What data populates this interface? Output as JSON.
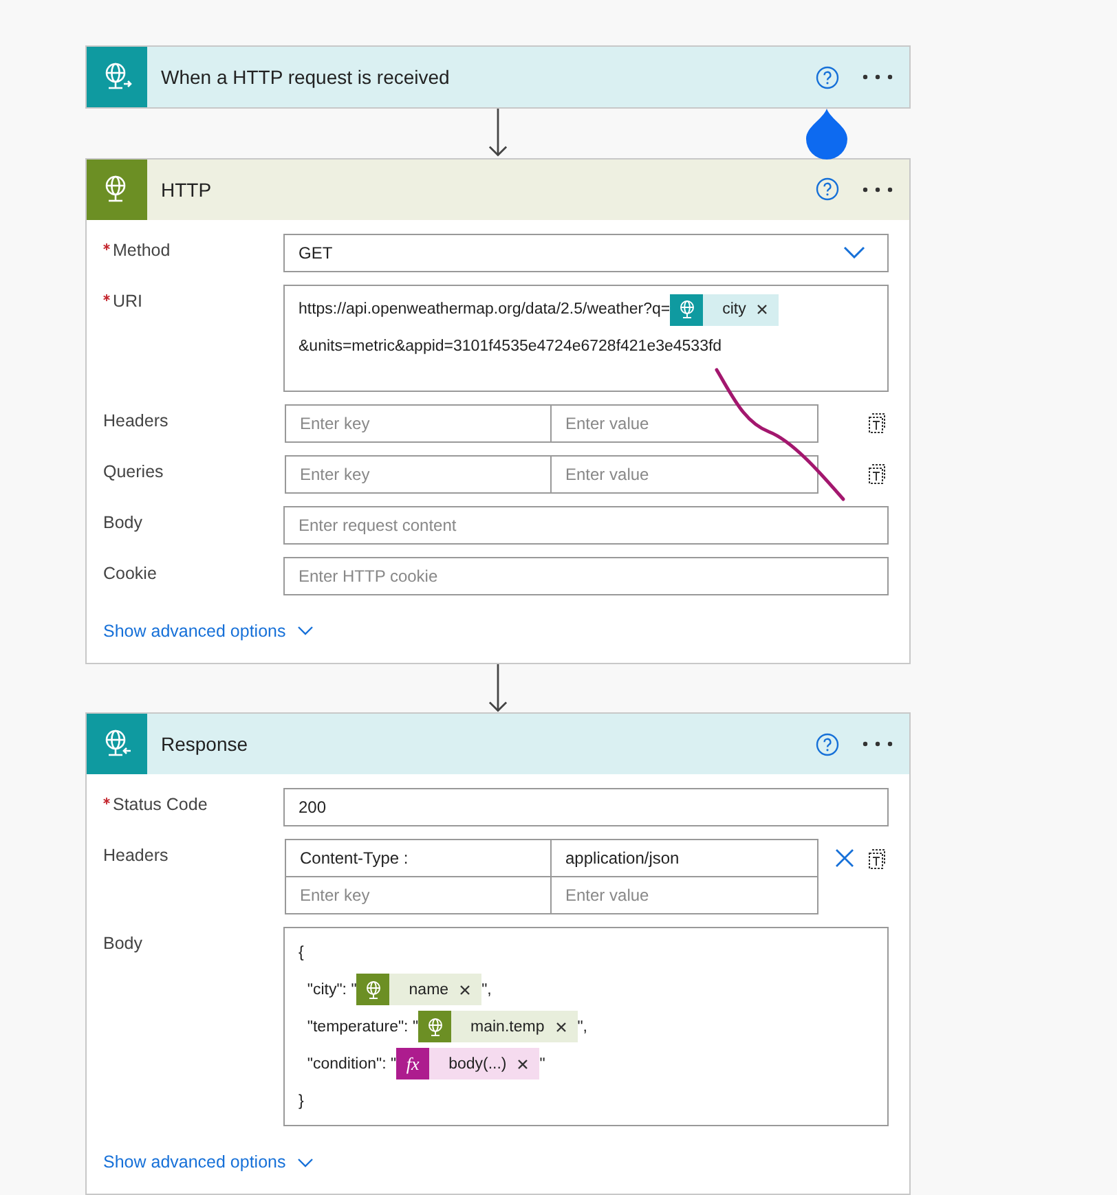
{
  "cards": [
    {
      "kind": "request",
      "title": "When a HTTP request is received"
    },
    {
      "kind": "http",
      "title": "HTTP",
      "fields": [
        {
          "kind": "dropdown",
          "label": "Method",
          "required": true,
          "value": "GET"
        },
        {
          "kind": "tokens",
          "label": "URI",
          "required": true,
          "lines": [
            [
              {
                "kind": "text",
                "text": "https://api.openweathermap.org/data/2.5/weather?q="
              },
              {
                "kind": "request_token",
                "label": "city"
              }
            ],
            [
              {
                "kind": "text",
                "text": "&units=metric&appid=3101f4535e4724e6728f421e3e4533fd"
              }
            ]
          ]
        },
        {
          "kind": "keyvalue",
          "label": "Headers",
          "required": false,
          "rows": [
            {
              "key": "",
              "key_placeholder": "Enter key",
              "value": "",
              "value_placeholder": "Enter value",
              "removable": false
            }
          ]
        },
        {
          "kind": "keyvalue",
          "label": "Queries",
          "required": false,
          "rows": [
            {
              "key": "",
              "key_placeholder": "Enter key",
              "value": "",
              "value_placeholder": "Enter value",
              "removable": false
            }
          ]
        },
        {
          "kind": "text",
          "label": "Body",
          "required": false,
          "placeholder": "Enter request content"
        },
        {
          "kind": "text",
          "label": "Cookie",
          "required": false,
          "placeholder": "Enter HTTP cookie"
        }
      ],
      "link": "Show advanced options"
    },
    {
      "kind": "response",
      "title": "Response",
      "fields": [
        {
          "kind": "text",
          "label": "Status Code",
          "required": true,
          "value": "200"
        },
        {
          "kind": "keyvalue",
          "label": "Headers",
          "required": false,
          "rows": [
            {
              "key": "Content-Type :",
              "value": "application/json",
              "removable": true
            },
            {
              "key": "",
              "key_placeholder": "Enter key",
              "value": "",
              "value_placeholder": "Enter value",
              "removable": false
            }
          ]
        },
        {
          "kind": "tokens",
          "label": "Body",
          "required": false,
          "lines": [
            [
              {
                "kind": "text",
                "text": "{"
              }
            ],
            [
              {
                "kind": "text",
                "text": "  \"city\": \""
              },
              {
                "kind": "http_token",
                "label": "name"
              },
              {
                "kind": "text",
                "text": "\","
              }
            ],
            [
              {
                "kind": "text",
                "text": "  \"temperature\": \""
              },
              {
                "kind": "http_token",
                "label": "main.temp"
              },
              {
                "kind": "text",
                "text": "\","
              }
            ],
            [
              {
                "kind": "text",
                "text": "  \"condition\": \""
              },
              {
                "kind": "expression_token",
                "icon_text": "fx",
                "label": "body(...)"
              },
              {
                "kind": "text",
                "text": "\""
              }
            ],
            [
              {
                "kind": "text",
                "text": "}"
              }
            ]
          ]
        }
      ],
      "link": "Show advanced options"
    }
  ]
}
